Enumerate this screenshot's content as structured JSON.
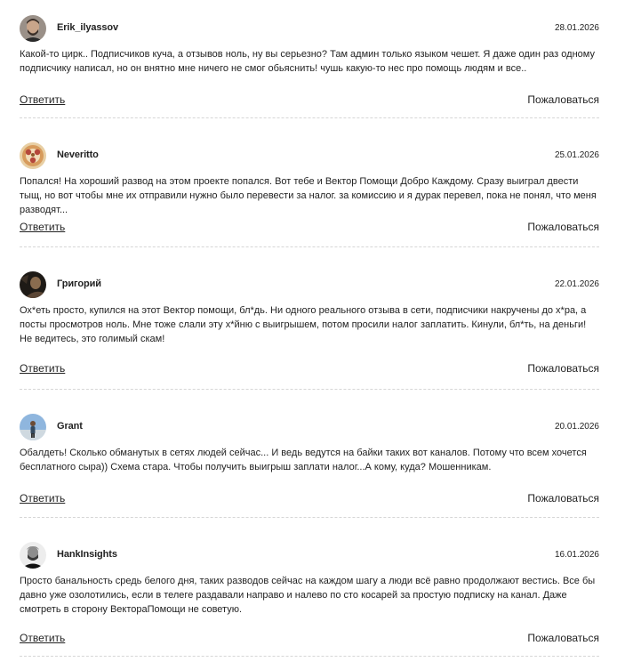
{
  "comments": [
    {
      "author": "Erik_ilyassov",
      "date": "28.01.2026",
      "avatar": "man-beard-avatar",
      "text": "Какой-то цирк.. Подписчиков куча, а отзывов ноль, ну вы серьезно? Там админ только языком чешет. Я даже один раз одному подписчику написал, но он внятно мне ничего не смог обьяснить! чушь какую-то нес про помощь людям и все..",
      "reply": "Ответить",
      "report": "Пожаловаться"
    },
    {
      "author": "Neveritto",
      "date": "25.01.2026",
      "avatar": "ornament-avatar",
      "text": "Попался! На хороший развод на этом проекте попался. Вот тебе и Вектор Помощи Добро Каждому. Сразу выиграл двести тыщ, но вот чтобы мне их отправили нужно было перевести за налог. за комиссию и я дурак перевел, пока не понял, что меня разводят...",
      "reply": "Ответить",
      "report": "Пожаловаться"
    },
    {
      "author": "Григорий",
      "date": "22.01.2026",
      "avatar": "dark-portrait-avatar",
      "text": "Ох*еть просто, купился на этот Вектор помощи, бл*дь. Ни одного реального отзыва в сети, подписчики накручены до х*ра, а посты просмотров ноль. Мне тоже слали эту х*йню с выигрышем, потом просили налог заплатить. Кинули, бл*ть, на деньги! Не ведитесь, это голимый скам!",
      "reply": "Ответить",
      "report": "Пожаловаться"
    },
    {
      "author": "Grant",
      "date": "20.01.2026",
      "avatar": "sky-person-avatar",
      "text": "Обалдеть! Сколько обманутых в сетях людей сейчас... И ведь ведутся на байки таких вот каналов. Потому что всем хочется бесплатного сыра)) Схема стара. Чтобы получить выигрыш заплати налог...А кому, куда? Мошенникам.",
      "reply": "Ответить",
      "report": "Пожаловаться"
    },
    {
      "author": "HankInsights",
      "date": "16.01.2026",
      "avatar": "bw-portrait-avatar",
      "text": "Просто банальность средь белого дня, таких разводов сейчас на каждом шагу а люди всё равно продолжают вестись. Все бы давно уже озолотились, если в телеге раздавали направо и налево по сто косарей за простую подписку на канал. Даже смотреть в сторону ВектораПомощи не советую.",
      "reply": "Ответить",
      "report": "Пожаловаться"
    }
  ]
}
